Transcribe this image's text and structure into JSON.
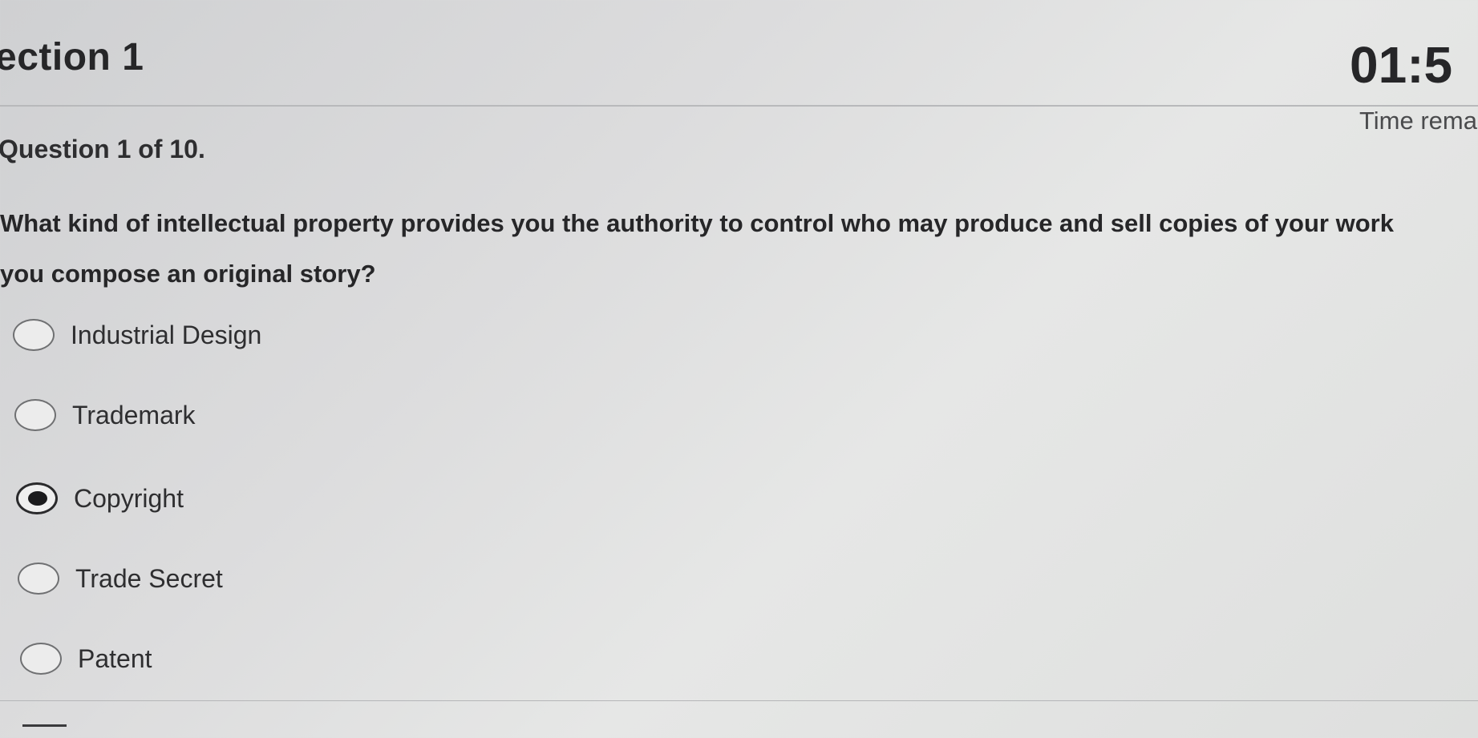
{
  "header": {
    "section_title": "ection 1",
    "timer": "01:5",
    "time_remaining_label": "Time remaini"
  },
  "question": {
    "counter": "Question 1 of 10.",
    "text_line1": "What kind of intellectual property provides you the authority to control who may produce and sell copies of your work",
    "text_line2": "you compose an original story?"
  },
  "options": [
    {
      "label": "Industrial Design",
      "selected": false
    },
    {
      "label": "Trademark",
      "selected": false
    },
    {
      "label": "Copyright",
      "selected": true
    },
    {
      "label": "Trade Secret",
      "selected": false
    },
    {
      "label": "Patent",
      "selected": false
    }
  ],
  "selected_option": "Copyright"
}
